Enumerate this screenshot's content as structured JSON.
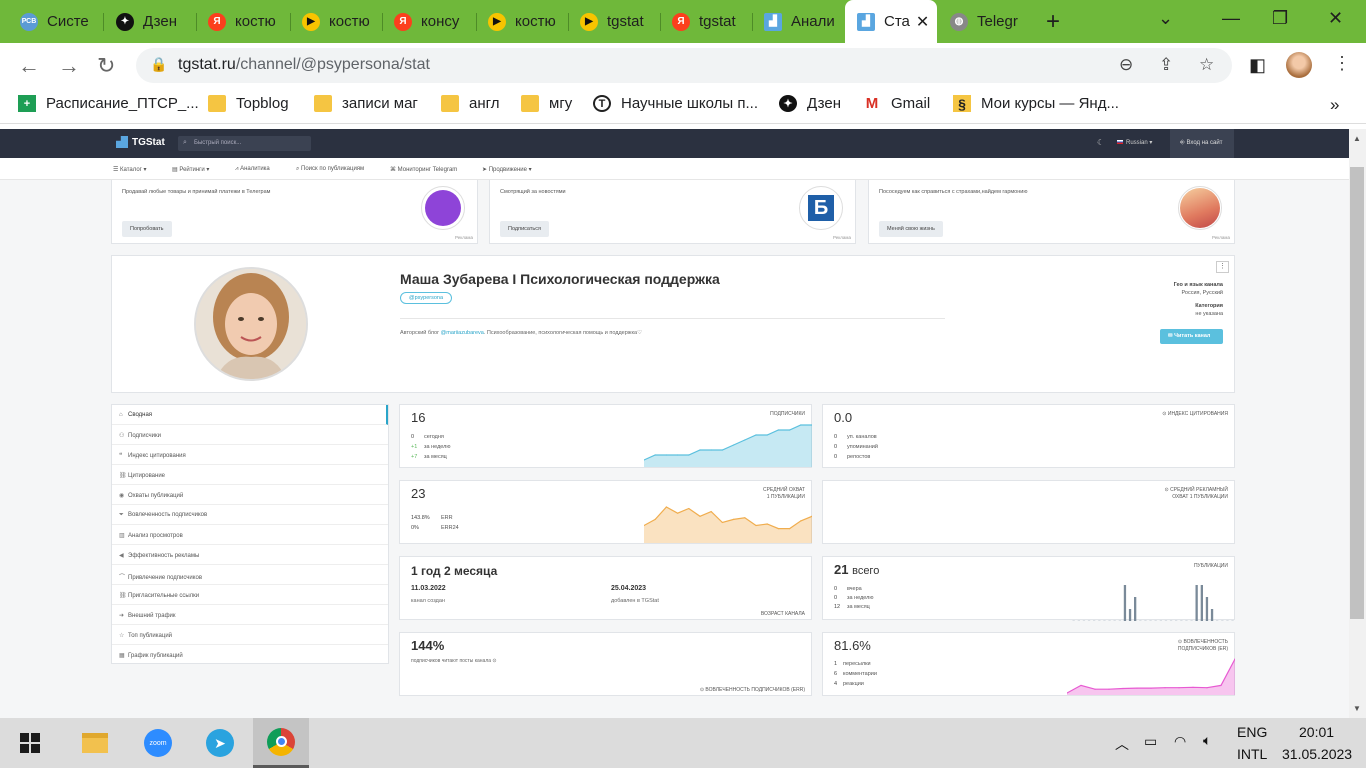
{
  "browser": {
    "tabs": [
      {
        "title": "Систе",
        "icon": "pcb-icon",
        "color": "#5b9bd5"
      },
      {
        "title": "Дзен",
        "icon": "dzen-icon",
        "color": "#111111"
      },
      {
        "title": "костю",
        "icon": "yandex-icon",
        "color": "#fc3f1d"
      },
      {
        "title": "костю",
        "icon": "yandex-video-icon",
        "color": "#f7c400"
      },
      {
        "title": "консу",
        "icon": "yandex-icon",
        "color": "#fc3f1d"
      },
      {
        "title": "костю",
        "icon": "yandex-video-icon",
        "color": "#f7c400"
      },
      {
        "title": "tgstat",
        "icon": "yandex-video-icon",
        "color": "#f7c400"
      },
      {
        "title": "tgstat",
        "icon": "yandex-icon",
        "color": "#fc3f1d"
      },
      {
        "title": "Анали",
        "icon": "tgstat-icon",
        "color": "#5aa6e0"
      },
      {
        "title": "Ста",
        "icon": "tgstat-icon",
        "color": "#5aa6e0",
        "active": true
      },
      {
        "title": "Telegr",
        "icon": "globe-icon",
        "color": "#888888"
      }
    ],
    "url_host": "tgstat.ru",
    "url_path": "/channel/@psypersona/stat",
    "bookmarks": [
      {
        "label": "Расписание_ПТСР_...",
        "icon": "sheets-icon"
      },
      {
        "label": "Topblog",
        "icon": "folder-icon"
      },
      {
        "label": "записи маг",
        "icon": "folder-icon"
      },
      {
        "label": "англ",
        "icon": "folder-icon"
      },
      {
        "label": "мгу",
        "icon": "folder-icon"
      },
      {
        "label": "Научные школы п...",
        "icon": "t-icon"
      },
      {
        "label": "Дзен",
        "icon": "dzen-icon"
      },
      {
        "label": "Gmail",
        "icon": "gmail-icon"
      },
      {
        "label": "Мои курсы — Янд...",
        "icon": "paragraph-icon"
      }
    ]
  },
  "site": {
    "logo": "TGStat",
    "search_placeholder": "Быстрый поиск...",
    "lang": "Russian",
    "login": "Вход на сайт",
    "menu": [
      "Каталог",
      "Рейтинги",
      "Аналитика",
      "Поиск по публикациям",
      "Мониторинг Telegram",
      "Продвижение"
    ],
    "ads": [
      {
        "text": "Продавай любые товары и принимай платежи в Телеграм",
        "button": "Попробовать",
        "mark": "Реклама",
        "color": "#8e44d8"
      },
      {
        "text": "Смотрящий за новостями",
        "button": "Подписаться",
        "mark": "Реклама",
        "color": "#1f5fa8"
      },
      {
        "text": "Пососедуем как справиться с страхами,найдем гармонию",
        "button": "Меняй свою жизнь",
        "mark": "Реклама",
        "color": "#e7a36a"
      }
    ],
    "channel": {
      "title": "Маша Зубарева I Психологическая поддержка",
      "handle": "@psypersona",
      "desc_prefix": "Авторский блог",
      "desc_link": "@mariiazubareva",
      "desc_suffix": ". Психообразование, психологическая помощь и поддержка♡",
      "geo_label": "Гео и язык канала",
      "geo_value": "Россия, Русский",
      "cat_label": "Категория",
      "cat_value": "не указана",
      "read_button": "Читать канал"
    },
    "nav": [
      {
        "label": "Сводная",
        "icon": "home-icon",
        "active": true
      },
      {
        "label": "Подписчики",
        "icon": "users-icon"
      },
      {
        "label": "Индекс цитирования",
        "icon": "quote-icon"
      },
      {
        "label": "Цитирование",
        "icon": "link-icon"
      },
      {
        "label": "Охваты публикаций",
        "icon": "eye-icon"
      },
      {
        "label": "Вовлеченность подписчиков",
        "icon": "filter-icon"
      },
      {
        "label": "Анализ просмотров",
        "icon": "bars-icon"
      },
      {
        "label": "Эффективность рекламы",
        "icon": "megaphone-icon"
      },
      {
        "label": "Привлечение подписчиков",
        "icon": "trend-icon"
      },
      {
        "label": "Пригласительные ссылки",
        "icon": "link-icon"
      },
      {
        "label": "Внешний трафик",
        "icon": "arrow-icon"
      },
      {
        "label": "Топ публикаций",
        "icon": "star-icon"
      },
      {
        "label": "График публикаций",
        "icon": "calendar-icon"
      }
    ],
    "cards": {
      "subs": {
        "value": "16",
        "caption": "ПОДПИСЧИКИ",
        "r1n": "0",
        "r1": "сегодня",
        "r2n": "+1",
        "r2": "за неделю",
        "r3n": "+7",
        "r3": "за месяц"
      },
      "cite": {
        "value": "0.0",
        "caption": "ИНДЕКС ЦИТИРОВАНИЯ",
        "r1n": "0",
        "r1": "уп. каналов",
        "r2n": "0",
        "r2": "упоминаний",
        "r3n": "0",
        "r3": "репостов"
      },
      "reach": {
        "value": "23",
        "caption1": "СРЕДНИЙ ОХВАТ",
        "caption2": "1 ПУБЛИКАЦИИ",
        "err1v": "143.8%",
        "err1": "ERR",
        "err2v": "0%",
        "err2": "ERR24"
      },
      "adreach": {
        "caption1": "СРЕДНИЙ РЕКЛАМНЫЙ",
        "caption2": "ОХВАТ 1 ПУБЛИКАЦИИ"
      },
      "age": {
        "value": "1 год 2 месяца",
        "d1": "11.03.2022",
        "d1l": "канал создан",
        "d2": "25.04.2023",
        "d2l": "добавлен в TGStat",
        "caption": "ВОЗРАСТ КАНАЛА"
      },
      "posts": {
        "value": "21",
        "unit": "всего",
        "caption": "ПУБЛИКАЦИИ",
        "r1n": "0",
        "r1": "вчера",
        "r2n": "0",
        "r2": "за неделю",
        "r3n": "12",
        "r3": "за месяц"
      },
      "read": {
        "value": "144%",
        "sub": "подписчиков читают посты канала",
        "caption": "ВОВЛЕЧЕННОСТЬ ПОДПИСЧИКОВ (ERR)"
      },
      "er": {
        "value": "81.6%",
        "caption1": "ВОВЛЕЧЕННОСТЬ",
        "caption2": "ПОДПИСЧИКОВ (ER)",
        "r1n": "1",
        "r1": "пересылки",
        "r2n": "6",
        "r2": "комментарии",
        "r3n": "4",
        "r3": "реакции"
      }
    }
  },
  "chart_data": [
    {
      "type": "area",
      "name": "subscribers",
      "values": [
        9,
        10,
        10,
        10,
        10,
        11,
        11,
        11,
        12,
        13,
        14,
        14,
        15,
        15,
        16,
        16
      ],
      "color": "#5bc0de"
    },
    {
      "type": "area",
      "name": "reach",
      "values": [
        10,
        14,
        22,
        18,
        21,
        16,
        19,
        12,
        14,
        15,
        10,
        11,
        8,
        8,
        13,
        16
      ],
      "color": "#f0ad4e"
    },
    {
      "type": "bar",
      "name": "publications",
      "values": [
        0,
        0,
        0,
        0,
        0,
        0,
        0,
        0,
        0,
        0,
        3,
        1,
        2,
        0,
        0,
        0,
        0,
        0,
        0,
        0,
        0,
        0,
        0,
        0,
        3,
        3,
        2,
        1,
        0,
        0,
        0,
        0
      ],
      "color": "#7a8a99"
    },
    {
      "type": "area",
      "name": "er",
      "values": [
        0,
        2,
        1,
        1,
        1.2,
        1.3,
        1.3,
        1.4,
        1.4,
        1.5,
        1.4,
        2,
        9
      ],
      "color": "#e75ad2"
    }
  ],
  "taskbar": {
    "lang1": "ENG",
    "lang2": "INTL",
    "time": "20:01",
    "date": "31.05.2023"
  }
}
